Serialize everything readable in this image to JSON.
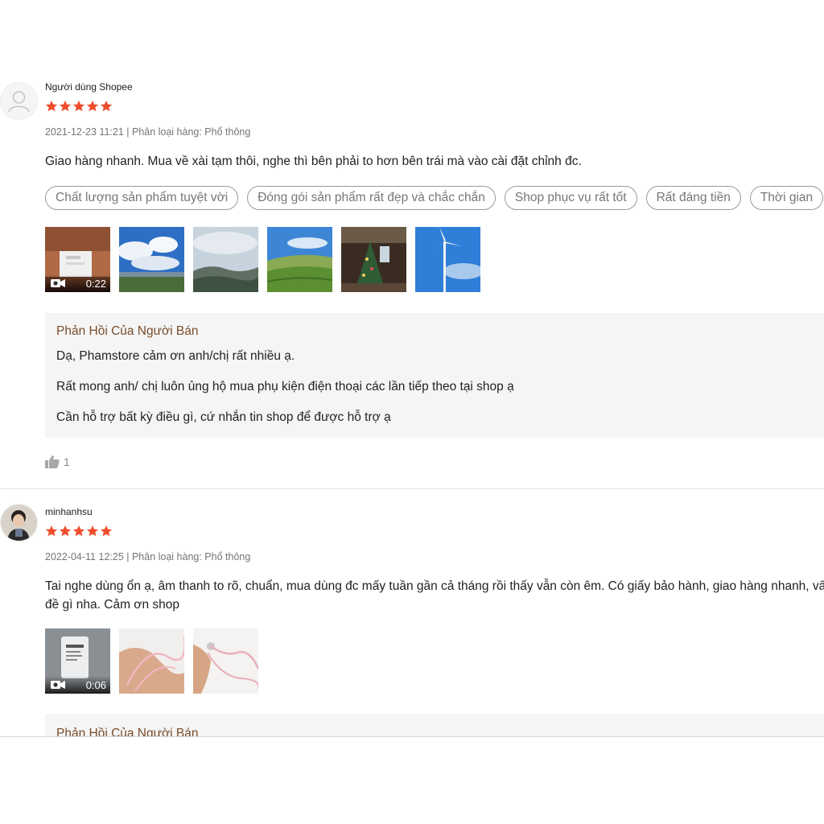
{
  "colors": {
    "star": "#ee4d2d",
    "reply_title": "#7a4d2b",
    "reply_bg": "#f5f5f5",
    "tag_border": "#9a9a9a"
  },
  "reviews": [
    {
      "username": "Người dùng Shopee",
      "rating": 5,
      "meta": "2021-12-23 11:21 | Phân loại hàng: Phổ thông",
      "content": "Giao hàng nhanh. Mua về xài tạm thôi, nghe thì bên phải to hơn bên trái mà vào cài đặt chỉnh đc.",
      "tags": [
        "Chất lượng sản phẩm tuyệt vời",
        "Đóng gói sản phẩm rất đẹp và chắc chắn",
        "Shop phục vụ rất tốt",
        "Rất đáng tiền",
        "Thời gian"
      ],
      "video_duration": "0:22",
      "media_icons": [
        "video-camera-icon"
      ],
      "reply": {
        "title": "Phản Hồi Của Người Bán",
        "lines": [
          "Dạ, Phamstore cảm ơn anh/chị rất nhiều ạ.",
          "Rất mong anh/ chị luôn ủng hộ mua phụ kiện điện thoại các lần tiếp theo tại shop ạ",
          "Cần hỗ trợ bất kỳ điều gì, cứ nhắn tin shop để được hỗ trợ ạ"
        ]
      },
      "likes": "1"
    },
    {
      "username": "minhanhsu",
      "rating": 5,
      "meta": "2022-04-11 12:25 | Phân loại hàng: Phổ thông",
      "content": "Tai nghe dùng ổn ạ, âm thanh to rõ, chuẩn, mua dùng đc mấy tuần gần cả tháng rồi thấy vẫn còn êm. Có giấy bảo hành, giao hàng nhanh, vấn đề gì nha. Cảm ơn shop",
      "video_duration": "0:06",
      "reply": {
        "title": "Phản Hồi Của Người Bán"
      }
    }
  ]
}
